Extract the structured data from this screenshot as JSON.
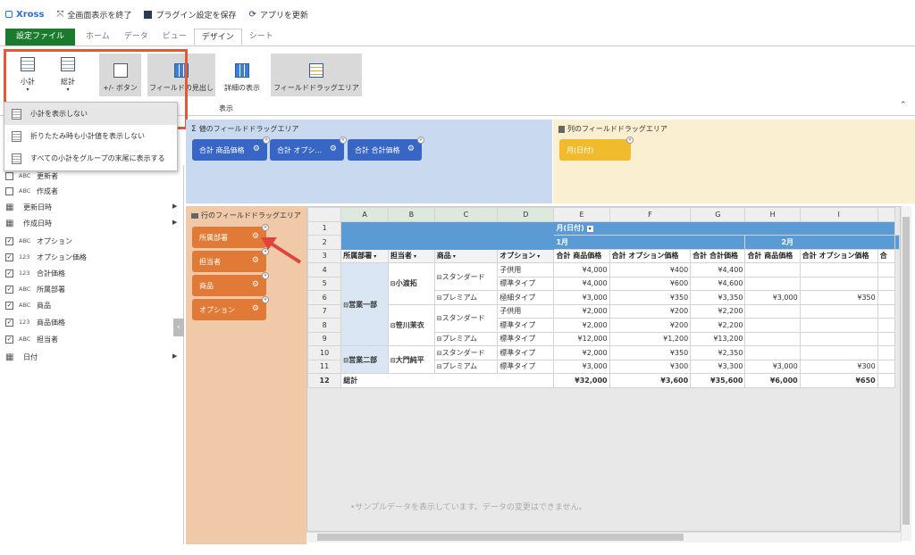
{
  "titlebar": {
    "app": "Xross",
    "exit_fullscreen": "全画面表示を終了",
    "save_plugin": "プラグイン設定を保存",
    "update_app": "アプリを更新"
  },
  "tabs": {
    "file": "設定ファイル",
    "home": "ホーム",
    "data": "データ",
    "view": "ビュー",
    "design": "デザイン",
    "sheet": "シート"
  },
  "ribbon": {
    "subtotal": "小計",
    "grandtotal": "総計",
    "plusminus": "+/- ボタン",
    "field_heading": "フィールドの見出し",
    "detail_view": "詳細の表示",
    "field_drag_area": "フィールドドラッグエリア",
    "group_label": "表示"
  },
  "dropdown": {
    "items": [
      "小計を表示しない",
      "折りたたみ時も小計値を表示しない",
      "すべての小計をグループの末尾に表示する"
    ]
  },
  "fields": [
    {
      "checked": false,
      "type": "ABC",
      "label": "更新者",
      "arrow": false
    },
    {
      "checked": false,
      "type": "ABC",
      "label": "作成者",
      "arrow": false
    },
    {
      "checked": false,
      "type": "cal",
      "label": "更新日時",
      "arrow": true
    },
    {
      "checked": false,
      "type": "cal",
      "label": "作成日時",
      "arrow": true
    },
    {
      "checked": true,
      "type": "ABC",
      "label": "オプション",
      "arrow": false
    },
    {
      "checked": true,
      "type": "123",
      "label": "オプション価格",
      "arrow": false
    },
    {
      "checked": true,
      "type": "123",
      "label": "合計価格",
      "arrow": false
    },
    {
      "checked": true,
      "type": "ABC",
      "label": "所属部署",
      "arrow": false
    },
    {
      "checked": true,
      "type": "ABC",
      "label": "商品",
      "arrow": false
    },
    {
      "checked": true,
      "type": "123",
      "label": "商品価格",
      "arrow": false
    },
    {
      "checked": true,
      "type": "ABC",
      "label": "担当者",
      "arrow": false
    },
    {
      "checked": false,
      "type": "cal",
      "label": "日付",
      "arrow": true
    }
  ],
  "zones": {
    "values_label": "値のフィールドドラッグエリア",
    "columns_label": "列のフィールドドラッグエリア",
    "rows_label": "行のフィールドドラッグエリア",
    "value_chips": [
      "合計 商品価格",
      "合計 オプシ...",
      "合計 合計価格"
    ],
    "column_chips": [
      "月(日付)"
    ],
    "row_chips": [
      "所属部署",
      "担当者",
      "商品",
      "オプション"
    ]
  },
  "grid": {
    "col_letters": [
      "A",
      "B",
      "C",
      "D",
      "E",
      "F",
      "G",
      "H",
      "I"
    ],
    "row1_label": "月(日付)",
    "month1": "1月",
    "month2": "2月",
    "headers": [
      "所属部署",
      "担当者",
      "商品",
      "オプション",
      "合計 商品価格",
      "合計 オプション価格",
      "合計 合計価格",
      "合計 商品価格",
      "合計 オプション価格",
      "合"
    ],
    "dept1": "営業一部",
    "dept2": "営業二部",
    "rep1": "小渡拓",
    "rep2": "笹川茉衣",
    "rep3": "大門純平",
    "prod_std": "スタンダード",
    "prod_prem": "プレミアム",
    "rows": [
      [
        "子供用",
        "¥4,000",
        "¥400",
        "¥4,400",
        "",
        ""
      ],
      [
        "標準タイプ",
        "¥4,000",
        "¥600",
        "¥4,600",
        "",
        ""
      ],
      [
        "極細タイプ",
        "¥3,000",
        "¥350",
        "¥3,350",
        "¥3,000",
        "¥350"
      ],
      [
        "子供用",
        "¥2,000",
        "¥200",
        "¥2,200",
        "",
        ""
      ],
      [
        "標準タイプ",
        "¥2,000",
        "¥200",
        "¥2,200",
        "",
        ""
      ],
      [
        "標準タイプ",
        "¥12,000",
        "¥1,200",
        "¥13,200",
        "",
        ""
      ],
      [
        "標準タイプ",
        "¥2,000",
        "¥350",
        "¥2,350",
        "",
        ""
      ],
      [
        "標準タイプ",
        "¥3,000",
        "¥300",
        "¥3,300",
        "¥3,000",
        "¥300"
      ]
    ],
    "total_label": "総計",
    "totals": [
      "¥32,000",
      "¥3,600",
      "¥35,600",
      "¥6,000",
      "¥650"
    ]
  },
  "sample_note": "•サンプルデータを表示しています。データの変更はできません。",
  "colors": {
    "file_tab": "#1a7a2e",
    "highlight": "#e05a3a",
    "value_chip": "#3866c4",
    "column_chip": "#f0bb2c",
    "row_chip": "#e07a36",
    "grid_header": "#5b9bd5"
  }
}
